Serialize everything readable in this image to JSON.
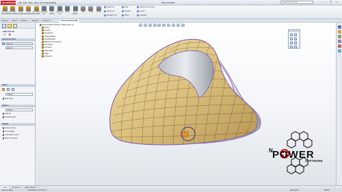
{
  "titlebar": {
    "app_logo": "SOLIDWORKS",
    "menus": [
      "File",
      "Edit",
      "View",
      "Insert",
      "Tools",
      "Window",
      "Help"
    ],
    "document_title": "Part1.SLDPRT",
    "search_placeholder": "Search Commands",
    "window_controls": [
      "—",
      "❐",
      "✕"
    ]
  },
  "ribbon": {
    "large_buttons": [
      {
        "label": "Extruded Boss/Base",
        "icon": "extrude-icon",
        "color": "#d9a23c"
      },
      {
        "label": "Revolved Boss/Base",
        "icon": "revolve-icon",
        "color": "#d9a23c"
      },
      {
        "label": "Swept Boss/Base",
        "icon": "sweep-icon",
        "color": "#d9a23c"
      },
      {
        "label": "Lofted Boss/Base",
        "icon": "loft-icon",
        "color": "#d9a23c"
      },
      {
        "label": "Boundary Boss/Base",
        "icon": "boundary-icon",
        "color": "#d9a23c"
      },
      {
        "label": "Extruded Cut",
        "icon": "cut-icon",
        "color": "#5b7bb4"
      },
      {
        "label": "Hole Wizard",
        "icon": "hole-icon",
        "color": "#5b7bb4"
      },
      {
        "label": "Revolved Cut",
        "icon": "revolve-cut-icon",
        "color": "#5b7bb4"
      },
      {
        "label": "Fillet",
        "icon": "fillet-icon",
        "color": "#5b7bb4"
      },
      {
        "label": "Linear Pattern",
        "icon": "pattern-icon",
        "color": "#5b7bb4"
      },
      {
        "label": "Rib",
        "icon": "rib-icon",
        "color": "#8fa5c7"
      },
      {
        "label": "Draft",
        "icon": "draft-icon",
        "color": "#8fa5c7"
      },
      {
        "label": "Shell",
        "icon": "shell-icon",
        "color": "#8fa5c7"
      }
    ],
    "small_buttons": [
      "Swept Cut",
      "Lofted Cut",
      "Boundary Cut",
      "Wrap",
      "Intersect",
      "Mirror",
      "Reference Geometry",
      "Curves",
      "Instant3D"
    ]
  },
  "tabs": [
    "Features",
    "Sketch",
    "Surfaces",
    "Evaluate",
    "DimXpert",
    "Power Surfacing RE"
  ],
  "active_tab": "Power Surfacing RE",
  "left_panel": {
    "title": "Split Smooth",
    "ok_icon": "✔",
    "cancel_icon": "✖",
    "sections": [
      {
        "header": "Selected Entities",
        "field": "Face<1>",
        "field2": "Edge<1>"
      },
      {
        "header": "Offset",
        "field": "3.00mm",
        "options": [
          "Both sides"
        ]
      },
      {
        "header": "Options",
        "field": "0.00mm",
        "options": [
          "Split All",
          "Show Preview"
        ]
      },
      {
        "header": "Display",
        "options": [
          "Show vertices",
          "Show Edges",
          "Transparent mesh",
          "Match Curvature"
        ]
      }
    ]
  },
  "tree": {
    "root": "Part1 (Default<<Default>_Display State 1>)",
    "items": [
      "History",
      "Sensors",
      "Annotations",
      "Surface Bodies",
      "Solid Bodies(1)",
      "Material <not specified>",
      "Front Plane",
      "Top Plane",
      "Right Plane",
      "Origin",
      "Imported1"
    ]
  },
  "model_tabs": [
    "Model",
    "3D Views",
    "Motion Study 1"
  ],
  "status": {
    "left": "Select an edge",
    "mid": "Coordinates: 24.4 0.0 0.0",
    "mid2": "Editing Part",
    "right": "MMGS"
  },
  "logo": {
    "top": "N",
    "main": "POWER",
    "sub": "SOFTWARE"
  },
  "colors": {
    "surface": "#dcc07e",
    "mesh": "#3a2a0e",
    "edge": "#7a5bb0",
    "accent": "#c8202a",
    "selection": "#e98a2c"
  }
}
